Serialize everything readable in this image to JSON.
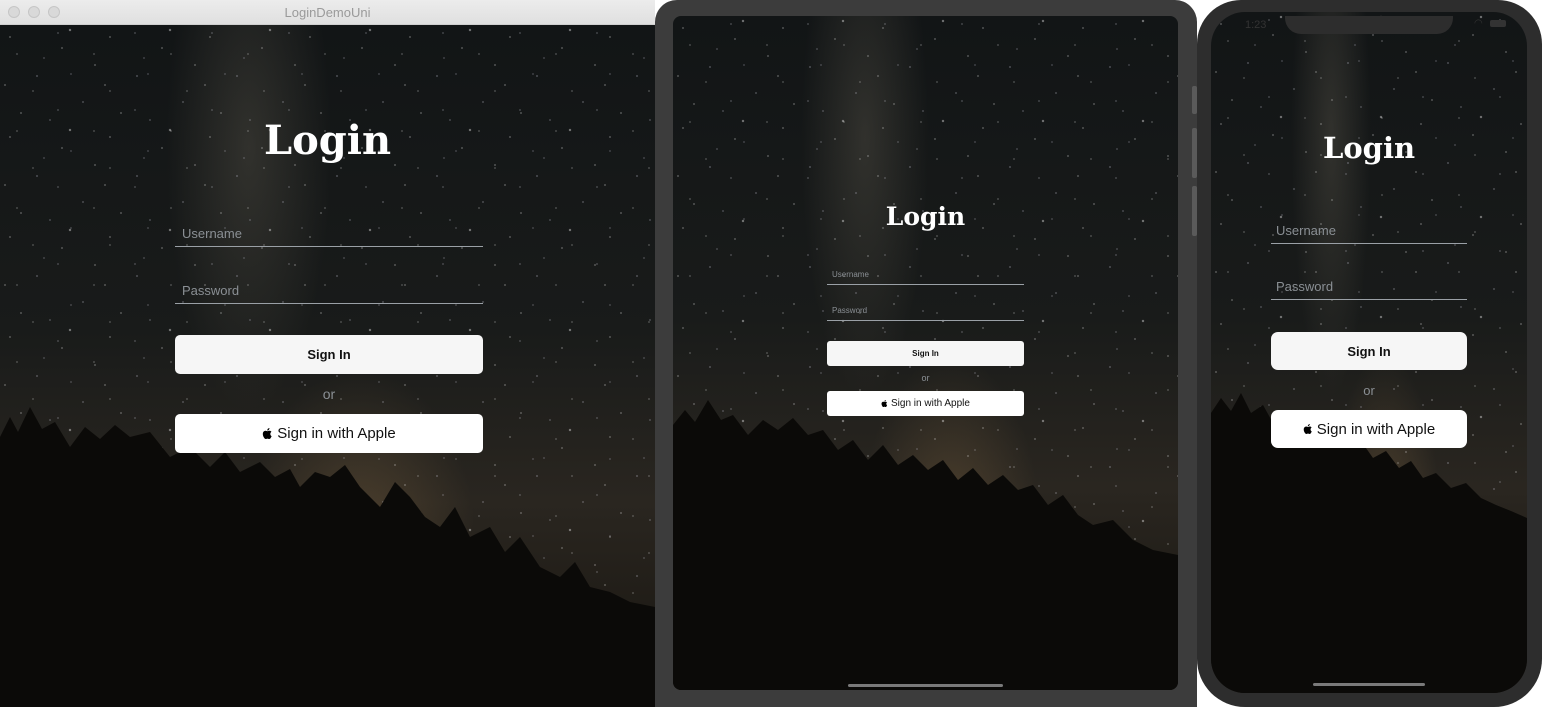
{
  "mac": {
    "window_title": "LoginDemoUni"
  },
  "iphone": {
    "status_time": "1:23"
  },
  "login": {
    "title": "Login",
    "username_placeholder": "Username",
    "password_placeholder": "Password",
    "sign_in_label": "Sign In",
    "or_label": "or",
    "apple_label": "Sign in with Apple",
    "apple_icon": "apple-logo-icon"
  },
  "colors": {
    "button_background": "#f6f6f6",
    "field_underline": "#9aa0a6",
    "placeholder_text": "#8a8f94",
    "title_text": "#ffffff"
  }
}
